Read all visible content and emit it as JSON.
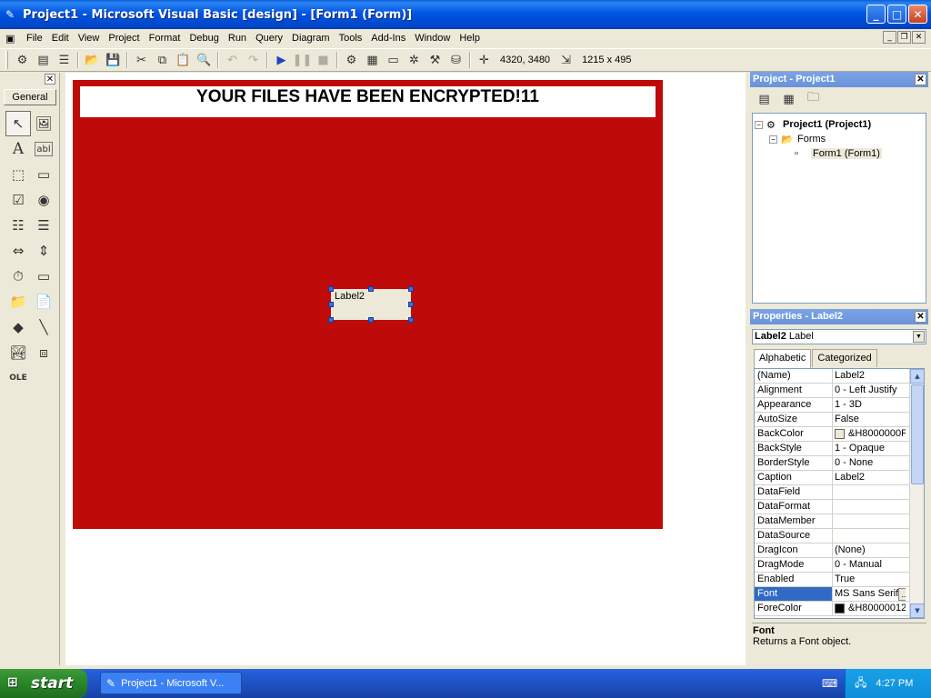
{
  "window": {
    "title": "Project1 - Microsoft Visual Basic [design] - [Form1 (Form)]",
    "minimize": "_",
    "maximize": "□",
    "close": "✕"
  },
  "menu": [
    "File",
    "Edit",
    "View",
    "Project",
    "Format",
    "Debug",
    "Run",
    "Query",
    "Diagram",
    "Tools",
    "Add-Ins",
    "Window",
    "Help"
  ],
  "toolbar": {
    "position": "4320, 3480",
    "size": "1215 x 495"
  },
  "toolbox": {
    "tab": "General",
    "close": "✕"
  },
  "form": {
    "title_label": "YOUR FILES HAVE BEEN ENCRYPTED!11",
    "label2": "Label2",
    "back_color": "#bf0a0a"
  },
  "project_explorer": {
    "title": "Project - Project1",
    "close": "✕",
    "tree": {
      "project": "Project1 (Project1)",
      "folder": "Forms",
      "form": "Form1 (Form1)"
    }
  },
  "properties": {
    "title": "Properties - Label2",
    "close": "✕",
    "object_name": "Label2",
    "object_type": "Label",
    "tabs": [
      "Alphabetic",
      "Categorized"
    ],
    "rows": [
      {
        "name": "(Name)",
        "value": "Label2"
      },
      {
        "name": "Alignment",
        "value": "0 - Left Justify"
      },
      {
        "name": "Appearance",
        "value": "1 - 3D"
      },
      {
        "name": "AutoSize",
        "value": "False"
      },
      {
        "name": "BackColor",
        "value": "&H8000000F"
      },
      {
        "name": "BackStyle",
        "value": "1 - Opaque"
      },
      {
        "name": "BorderStyle",
        "value": "0 - None"
      },
      {
        "name": "Caption",
        "value": "Label2"
      },
      {
        "name": "DataField",
        "value": ""
      },
      {
        "name": "DataFormat",
        "value": ""
      },
      {
        "name": "DataMember",
        "value": ""
      },
      {
        "name": "DataSource",
        "value": ""
      },
      {
        "name": "DragIcon",
        "value": "(None)"
      },
      {
        "name": "DragMode",
        "value": "0 - Manual"
      },
      {
        "name": "Enabled",
        "value": "True"
      },
      {
        "name": "Font",
        "value": "MS Sans Serif"
      },
      {
        "name": "ForeColor",
        "value": "&H80000012"
      }
    ],
    "description_title": "Font",
    "description_text": "Returns a Font object."
  },
  "taskbar": {
    "start": "start",
    "task": "Project1 - Microsoft V...",
    "clock": "4:27 PM"
  }
}
